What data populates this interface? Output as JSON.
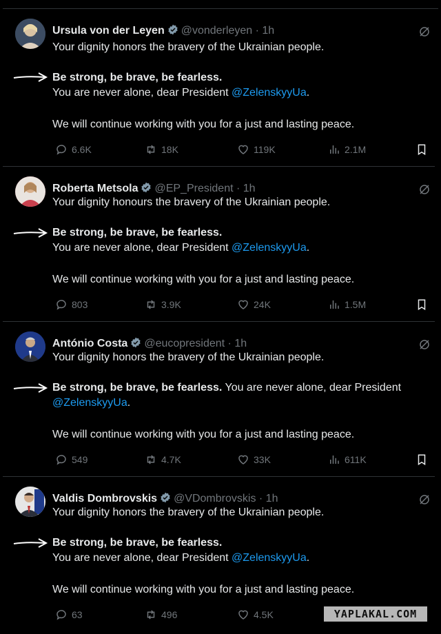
{
  "tweets": [
    {
      "name": "Ursula von der Leyen",
      "handle": "@vonderleyen",
      "time": "· 1h",
      "line1": "Your dignity honors the bravery of the Ukrainian people.",
      "bold": "Be strong, be brave, be fearless.",
      "line3a": "You are never alone, dear President ",
      "mention": "@ZelenskyyUa",
      "line3b": ".",
      "line4": "We will continue working with you for a just and lasting peace.",
      "replies": "6.6K",
      "reposts": "18K",
      "likes": "119K",
      "views": "2.1M",
      "avatar_color": "#4a5a70"
    },
    {
      "name": "Roberta Metsola",
      "handle": "@EP_President",
      "time": "· 1h",
      "line1": "Your dignity honours the bravery of the Ukrainian people.",
      "bold": "Be strong, be brave, be fearless.",
      "line3a": "You are never alone, dear President ",
      "mention": "@ZelenskyyUa",
      "line3b": ".",
      "line4": "We will continue working with you for a just and lasting peace.",
      "replies": "803",
      "reposts": "3.9K",
      "likes": "24K",
      "views": "1.5M",
      "avatar_color": "#c9414e"
    },
    {
      "name": "António Costa",
      "handle": "@eucopresident",
      "time": "· 1h",
      "line1": "Your dignity honors the bravery of the Ukrainian people.",
      "bold": "Be strong, be brave, be fearless.",
      "line3a": " You are never alone, dear President",
      "mention": "@ZelenskyyUa",
      "line3b": ".",
      "line4": "We will continue working with you for a just and lasting peace.",
      "replies": "549",
      "reposts": "4.7K",
      "likes": "33K",
      "views": "611K",
      "avatar_color": "#2a3c7a"
    },
    {
      "name": "Valdis Dombrovskis",
      "handle": "@VDombrovskis",
      "time": "· 1h",
      "line1": "Your dignity honors the bravery of the Ukrainian people.",
      "bold": "Be strong, be brave, be fearless.",
      "line3a": "You are never alone, dear President ",
      "mention": "@ZelenskyyUa",
      "line3b": ".",
      "line4": "We will continue working with you for a just and lasting peace.",
      "replies": "63",
      "reposts": "496",
      "likes": "4.5K",
      "views": "",
      "avatar_color": "#6a6f78"
    }
  ],
  "watermark": "YAPLAKAL.COM",
  "colors": {
    "background": "#000000",
    "text": "#e7e9ea",
    "muted": "#71767b",
    "link": "#1d9bf0",
    "verified": "#829aab"
  }
}
